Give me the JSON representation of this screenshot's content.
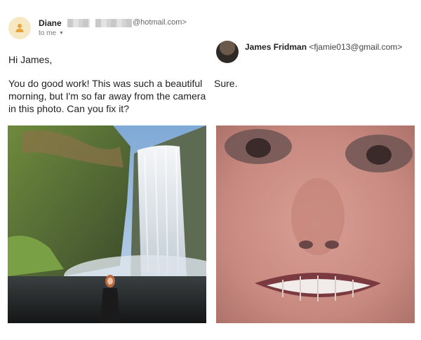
{
  "email": {
    "sender_name": "Diane",
    "sender_domain": "@hotmail.com>",
    "recipient_label": "to me",
    "greeting": "Hi James,",
    "body": "You do good work! This was such a beautiful morning, but I'm so far away from the camera in this photo. Can you fix it?"
  },
  "reply": {
    "sender_name": "James Fridman",
    "sender_email": "<fjamie013@gmail.com>",
    "message": "Sure."
  },
  "icons": {
    "sender_avatar": "person-icon",
    "dropdown": "chevron-down-icon"
  },
  "colors": {
    "avatar_bg": "#f6e8c3",
    "avatar_icon": "#e8a33d"
  }
}
